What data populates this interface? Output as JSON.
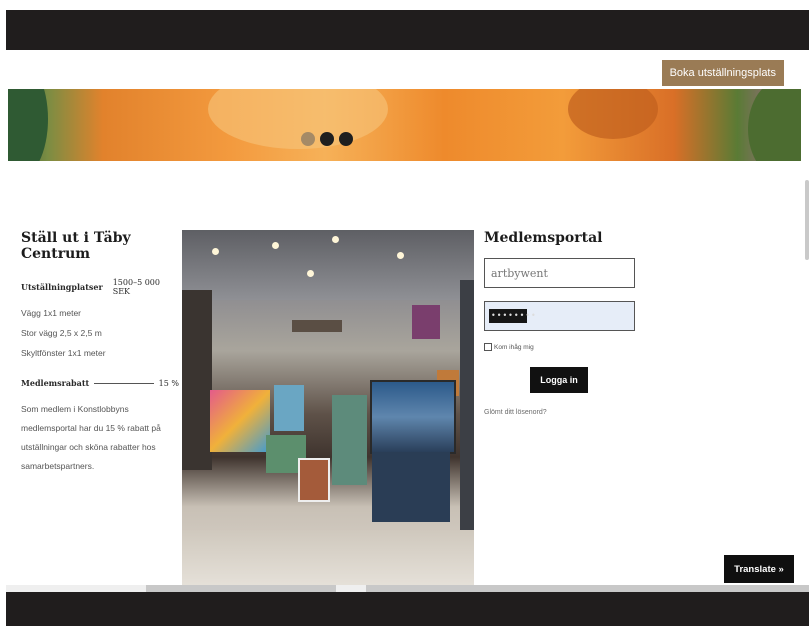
{
  "header": {
    "book_button_label": "Boka utställningsplats"
  },
  "hero": {
    "carousel_active_index": 0,
    "carousel_count": 3
  },
  "info": {
    "title": "Ställ ut i Täby Centrum",
    "spaces_label": "Utställningplatser",
    "spaces_price": "1500–5 000 SEK",
    "space_items": [
      "Vägg 1x1 meter",
      "Stor vägg 2,5 x 2,5 m",
      "Skyltfönster 1x1 meter"
    ],
    "discount_label": "Medlemsrabatt",
    "discount_value": "15 %",
    "discount_text": "Som medlem i Konstlobbyns medlemsportal har du 15 % rabatt på utställningar och sköna rabatter hos samarbetspartners."
  },
  "login": {
    "title": "Medlemsportal",
    "username_value": "artbywent",
    "password_mask": "••••••••",
    "remember_label": "Kom ihåg mig",
    "remember_checked": false,
    "login_label": "Logga in",
    "forgot_label": "Glömt ditt lösenord?"
  },
  "translate": {
    "label": "Translate »"
  },
  "colors": {
    "accent": "#9a7b55",
    "dark_bar": "#201d1d",
    "button": "#111111"
  }
}
